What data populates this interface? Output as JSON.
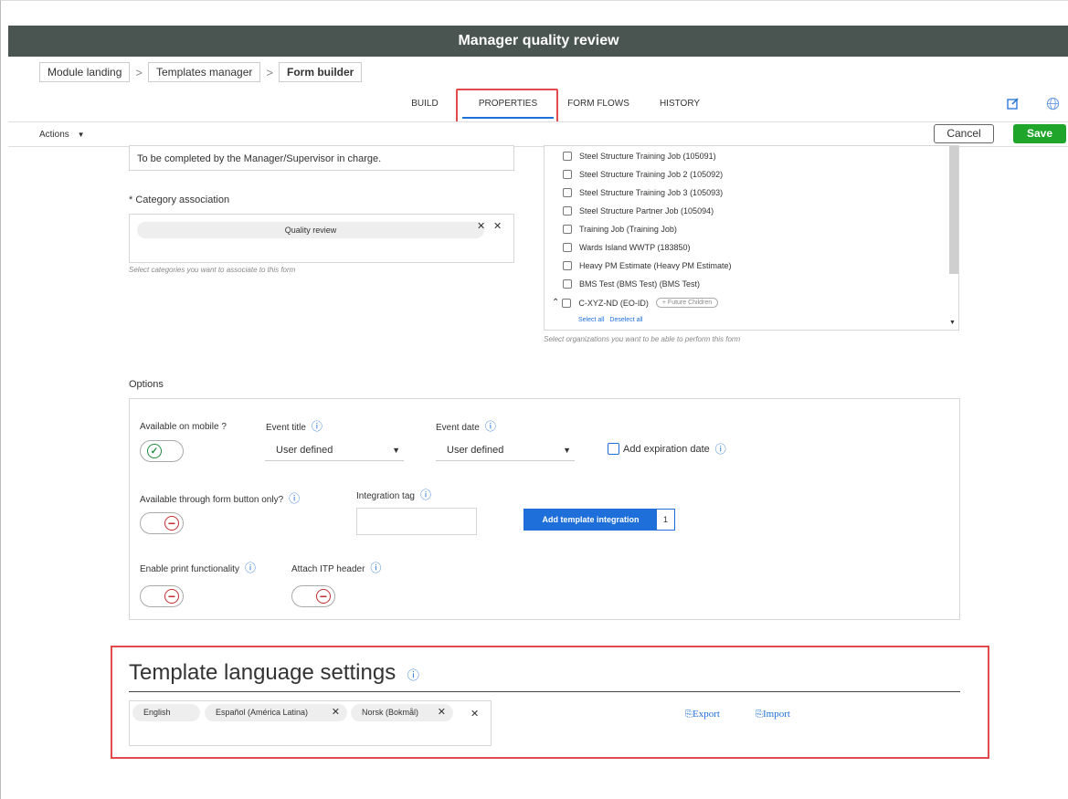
{
  "app": {
    "title": "Manager quality review"
  },
  "breadcrumb": [
    "Module landing",
    "Templates manager",
    "Form builder"
  ],
  "tabs": [
    "BUILD",
    "PROPERTIES",
    "FORM FLOWS",
    "HISTORY"
  ],
  "active_tab": "PROPERTIES",
  "toolbar": {
    "actions_label": "Actions",
    "cancel_label": "Cancel",
    "save_label": "Save"
  },
  "description": {
    "value": "To be completed by the Manager/Supervisor in charge."
  },
  "category": {
    "label": "* Category association",
    "chip": "Quality review",
    "hint": "Select categories you want to associate to this form"
  },
  "organizations": {
    "items": [
      "Steel Structure Training Job (105091)",
      "Steel Structure Training Job 2 (105092)",
      "Steel Structure Training Job 3 (105093)",
      "Steel Structure Partner Job (105094)",
      "Training Job (Training Job)",
      "Wards Island WWTP (183850)",
      "Heavy PM Estimate (Heavy PM Estimate)",
      "BMS Test (BMS Test) (BMS Test)",
      "C-XYZ-ND (EO-ID)"
    ],
    "future_children": "+ Future Children",
    "select_all": "Select all",
    "deselect_all": "Deselect all",
    "hint": "Select organizations you want to be able to perform this form"
  },
  "options": {
    "heading": "Options",
    "available_mobile": "Available on mobile ?",
    "event_title_label": "Event title",
    "event_title_value": "User defined",
    "event_date_label": "Event date",
    "event_date_value": "User defined",
    "add_expiration": "Add expiration date",
    "form_button_only": "Available through form button only?",
    "integration_tag": "Integration tag",
    "add_integration": "Add template integration",
    "integration_count": "1",
    "enable_print": "Enable print functionality",
    "attach_itp": "Attach ITP header"
  },
  "language": {
    "title": "Template language settings",
    "chips": [
      "English",
      "Español (América Latina)",
      "Norsk (Bokmål)"
    ],
    "export": "Export",
    "import": "Import"
  },
  "colors": {
    "accent": "#1e6fd9",
    "save": "#1fa52a",
    "titlebar": "#4a5451",
    "highlight": "#e14b4b"
  }
}
